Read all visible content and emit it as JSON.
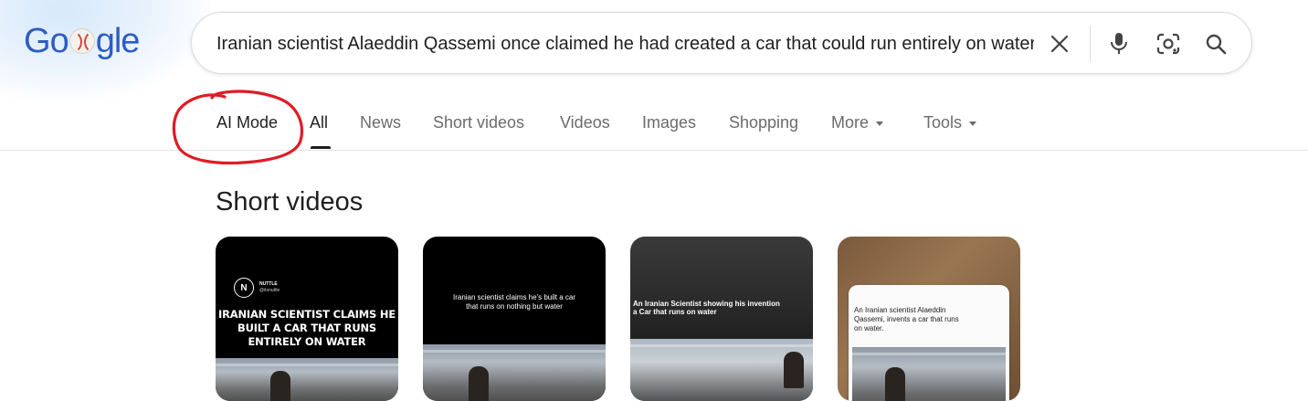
{
  "logo": {
    "text": "Google"
  },
  "search": {
    "query": "Iranian scientist Alaeddin Qassemi once claimed he had created a car that could run entirely on water",
    "clear_icon": "close-icon",
    "mic_icon": "mic-icon",
    "lens_icon": "lens-icon",
    "search_icon": "search-icon"
  },
  "tabs": {
    "ai_mode": "AI Mode",
    "all": "All",
    "news": "News",
    "short_videos": "Short videos",
    "videos": "Videos",
    "images": "Images",
    "shopping": "Shopping",
    "more": "More",
    "tools": "Tools"
  },
  "section": {
    "title": "Short videos"
  },
  "cards": [
    {
      "brand": "NUTTLE",
      "handle": "@itsnuttle",
      "headline_lines": [
        "IRANIAN SCIENTIST CLAIMS HE",
        "BUILT A CAR THAT RUNS",
        "ENTIRELY ON WATER"
      ]
    },
    {
      "caption_lines": [
        "Iranian scientist claims he's built a car",
        "that runs on nothing but water"
      ]
    },
    {
      "caption_lines": [
        "An Iranian Scientist showing his invention",
        "a Car that runs on water"
      ]
    },
    {
      "caption_lines": [
        "An Iranian scientist Alaeddin",
        "Qassemi, invents a car that runs",
        "on water."
      ]
    }
  ],
  "colors": {
    "annotation": "#e01b24",
    "logo_blue": "#2c5cc5",
    "active_tab": "#1f1f1f",
    "inactive_tab": "#6b6b6b"
  }
}
